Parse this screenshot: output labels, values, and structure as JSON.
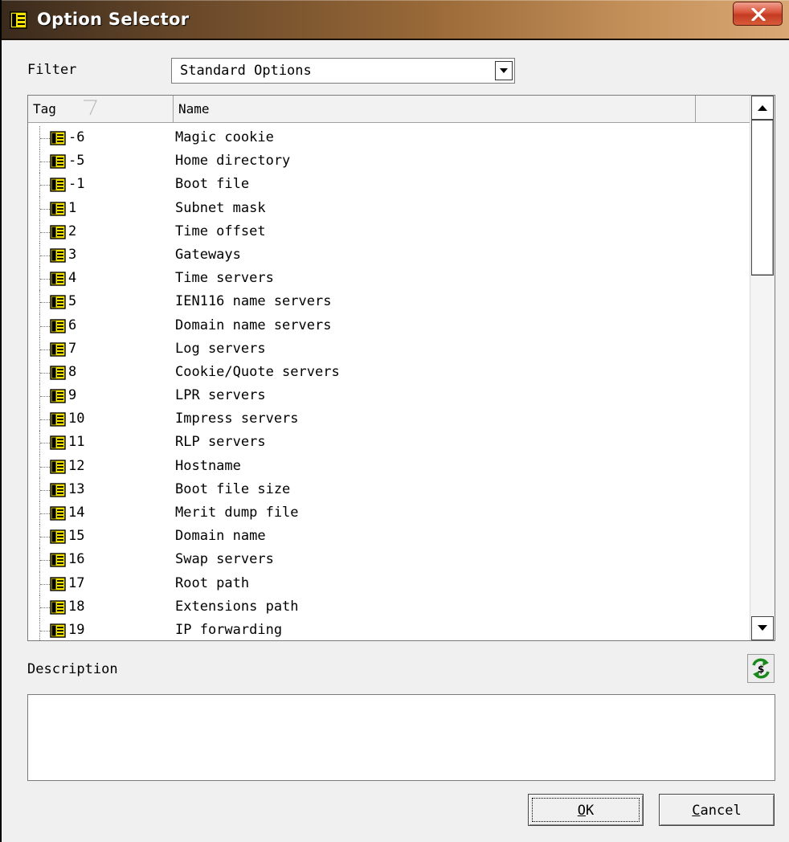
{
  "window": {
    "title": "Option Selector"
  },
  "filter": {
    "label": "Filter",
    "selected": "Standard Options"
  },
  "list": {
    "columns": [
      "Tag",
      "Name"
    ],
    "rows": [
      {
        "tag": "-6",
        "name": "Magic cookie"
      },
      {
        "tag": "-5",
        "name": "Home directory"
      },
      {
        "tag": "-1",
        "name": "Boot file"
      },
      {
        "tag": "1",
        "name": "Subnet mask"
      },
      {
        "tag": "2",
        "name": "Time offset"
      },
      {
        "tag": "3",
        "name": "Gateways"
      },
      {
        "tag": "4",
        "name": "Time servers"
      },
      {
        "tag": "5",
        "name": "IEN116 name servers"
      },
      {
        "tag": "6",
        "name": "Domain name servers"
      },
      {
        "tag": "7",
        "name": "Log servers"
      },
      {
        "tag": "8",
        "name": "Cookie/Quote servers"
      },
      {
        "tag": "9",
        "name": "LPR servers"
      },
      {
        "tag": "10",
        "name": "Impress servers"
      },
      {
        "tag": "11",
        "name": "RLP servers"
      },
      {
        "tag": "12",
        "name": "Hostname"
      },
      {
        "tag": "13",
        "name": "Boot file size"
      },
      {
        "tag": "14",
        "name": "Merit dump file"
      },
      {
        "tag": "15",
        "name": "Domain name"
      },
      {
        "tag": "16",
        "name": "Swap servers"
      },
      {
        "tag": "17",
        "name": "Root path"
      },
      {
        "tag": "18",
        "name": "Extensions path"
      },
      {
        "tag": "19",
        "name": "IP forwarding"
      }
    ],
    "row_icon": "option-icon",
    "sort_indicator": "sort-arrow-icon"
  },
  "description": {
    "label": "Description",
    "value": "",
    "refresh_icon": "refresh-icon"
  },
  "buttons": {
    "ok": "OK",
    "cancel": "Cancel"
  },
  "colors": {
    "titlebar_start": "#3a2a1c",
    "titlebar_end": "#d9a874",
    "close_button": "#c33b22",
    "icon_yellow": "#f5e400"
  }
}
